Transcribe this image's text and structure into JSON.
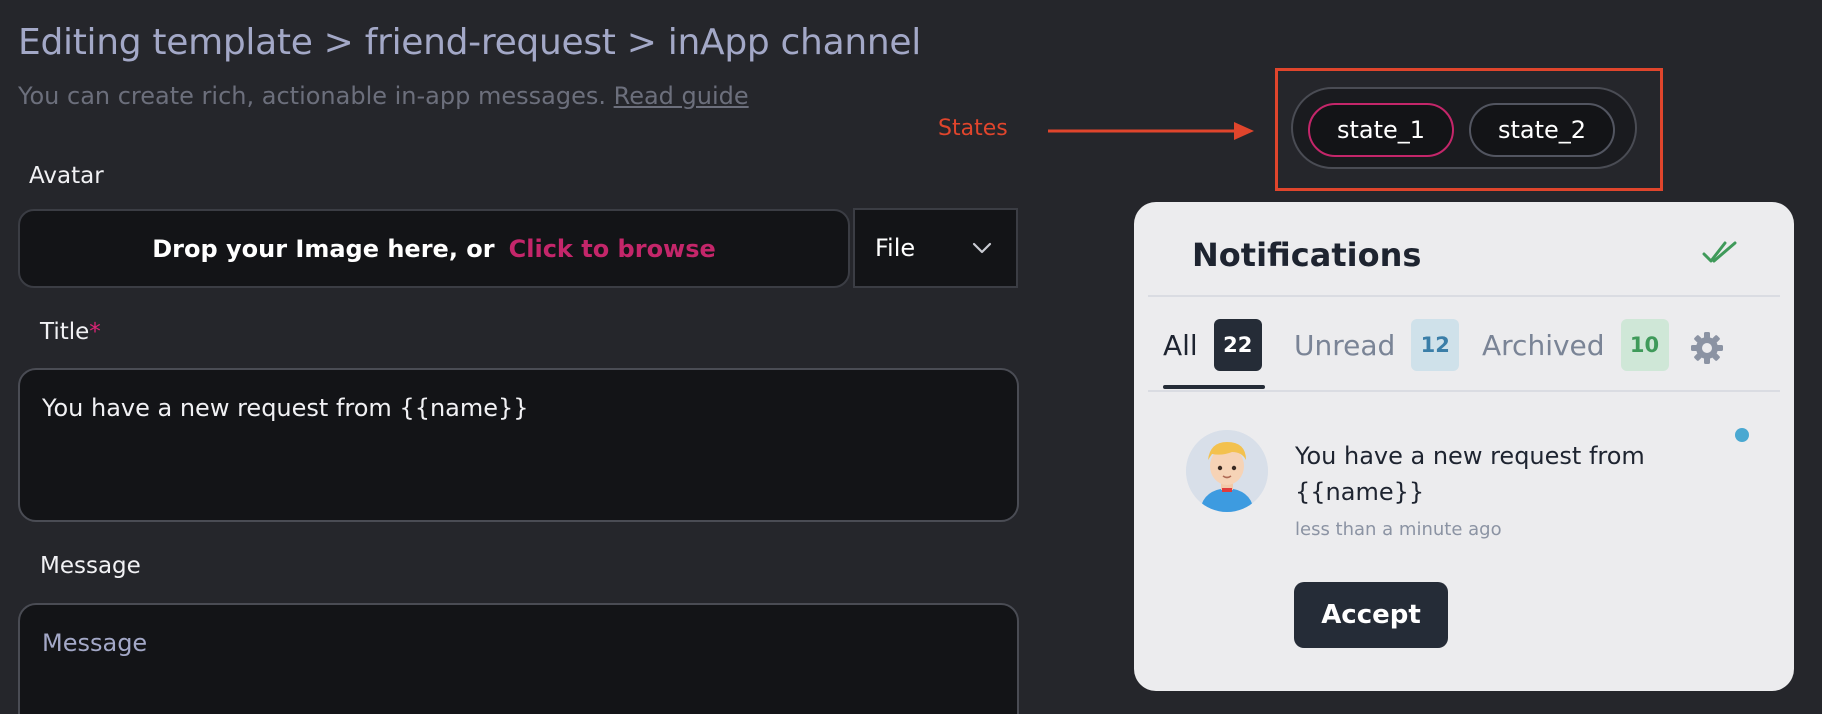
{
  "header": {
    "title": "Editing template > friend-request > inApp channel",
    "subtitle": "You can create rich, actionable in-app messages.",
    "guide_link": "Read guide"
  },
  "avatar_field": {
    "label": "Avatar",
    "drop_text": "Drop your Image here, or",
    "browse_text": "Click to browse",
    "source_select": "File"
  },
  "title_field": {
    "label": "Title",
    "required_mark": "*",
    "value": "You have a new request from {{name}}"
  },
  "message_field": {
    "label": "Message",
    "placeholder": "Message"
  },
  "annotation": {
    "label": "States",
    "color": "#e0452c"
  },
  "states": {
    "items": [
      {
        "label": "state_1",
        "selected": true
      },
      {
        "label": "state_2",
        "selected": false
      }
    ],
    "accent": "#c4266a"
  },
  "notifications": {
    "title": "Notifications",
    "mark_all_read_icon": "double-check-icon",
    "tabs": [
      {
        "label": "All",
        "count": "22",
        "active": true
      },
      {
        "label": "Unread",
        "count": "12",
        "active": false
      },
      {
        "label": "Archived",
        "count": "10",
        "active": false
      }
    ],
    "settings_icon": "gear-icon",
    "item": {
      "text": "You have a new request from {{name}}",
      "time": "less than a minute ago",
      "action_label": "Accept",
      "unread": true
    }
  }
}
